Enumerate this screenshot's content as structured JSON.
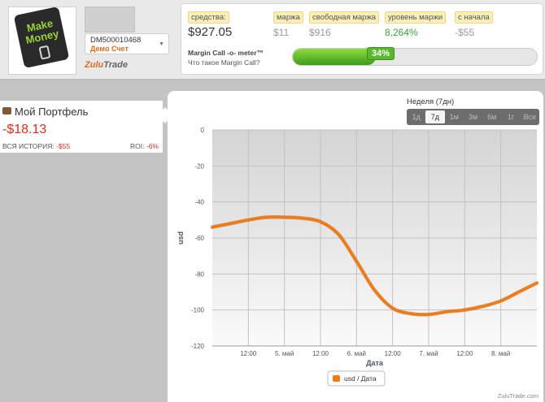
{
  "profile": {
    "avatar_text": "Make Money",
    "account_id": "DM500010468",
    "account_type": "Демо Счет",
    "logo_part1": "Zulu",
    "logo_part2": "Trade"
  },
  "stats": {
    "funds_label": "средства:",
    "funds_value": "$927.05",
    "margin_label": "маржа",
    "margin_value": "$11",
    "free_margin_label": "свободная маржа",
    "free_margin_value": "$916",
    "margin_level_label": "уровень маржи",
    "margin_level_value": "8,264%",
    "since_start_label": "с начала",
    "since_start_value": "-$55"
  },
  "margin_call": {
    "title": "Margin Call -o- meter™",
    "link": "Что такое Margin Call?",
    "percent_label": "34%",
    "percent": 34
  },
  "portfolio": {
    "title": "Мой Портфель",
    "value": "-$18.13",
    "history_label": "ВСЯ ИСТОРИЯ:",
    "history_value": "-$55",
    "roi_label": "ROI:",
    "roi_value": "-6%"
  },
  "range": {
    "title": "Неделя (7дн)",
    "tabs": [
      "1д",
      "7д",
      "1м",
      "3м",
      "6м",
      "1г",
      "Все"
    ],
    "active": "7д"
  },
  "chart_data": {
    "type": "line",
    "title": "",
    "xlabel": "Дата",
    "ylabel": "usd",
    "ylim": [
      -120,
      0
    ],
    "yticks": [
      0,
      -20,
      -40,
      -60,
      -80,
      -100,
      -120
    ],
    "xticks": [
      {
        "t": 1,
        "label": "12:00"
      },
      {
        "t": 2,
        "label": "5. май"
      },
      {
        "t": 3,
        "label": "12:00"
      },
      {
        "t": 4,
        "label": "6. май"
      },
      {
        "t": 5,
        "label": "12:00"
      },
      {
        "t": 6,
        "label": "7. май"
      },
      {
        "t": 7,
        "label": "12:00"
      },
      {
        "t": 8,
        "label": "8. май"
      }
    ],
    "xlim": [
      0,
      9
    ],
    "series": [
      {
        "name": "usd / Дата",
        "color": "#f07a14",
        "x": [
          0,
          0.5,
          1,
          1.5,
          2,
          2.5,
          3,
          3.5,
          4,
          4.5,
          5,
          5.5,
          6,
          6.5,
          7,
          7.5,
          8,
          8.5,
          9
        ],
        "y": [
          -54,
          -52,
          -50,
          -48.5,
          -48.5,
          -49,
          -51,
          -58,
          -73,
          -89,
          -99,
          -102,
          -102.5,
          -101,
          -100,
          -98,
          -95,
          -90,
          -85
        ]
      }
    ],
    "legend": "bottom-center",
    "grid": true
  },
  "footer": "ZuluTrade.com"
}
